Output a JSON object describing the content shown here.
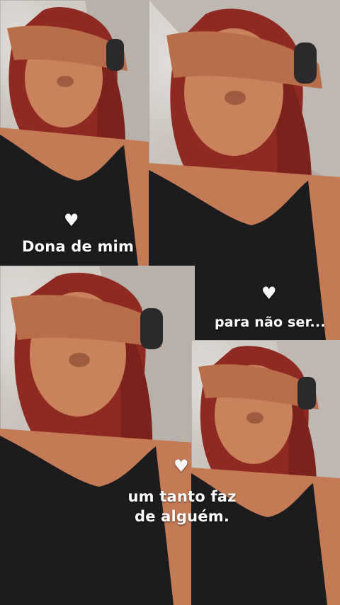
{
  "captions": {
    "first": "Dona de mim",
    "second": "para não ser...",
    "third_line1": "um tanto faz",
    "third_line2": "de alguém."
  },
  "icons": {
    "heart": "♥"
  },
  "colors": {
    "caption": "#ffffff",
    "swimsuit": "#1c1c1e",
    "hair": "#8f2a22",
    "skin": "#c9825c",
    "sand": "#d7d0c9"
  }
}
